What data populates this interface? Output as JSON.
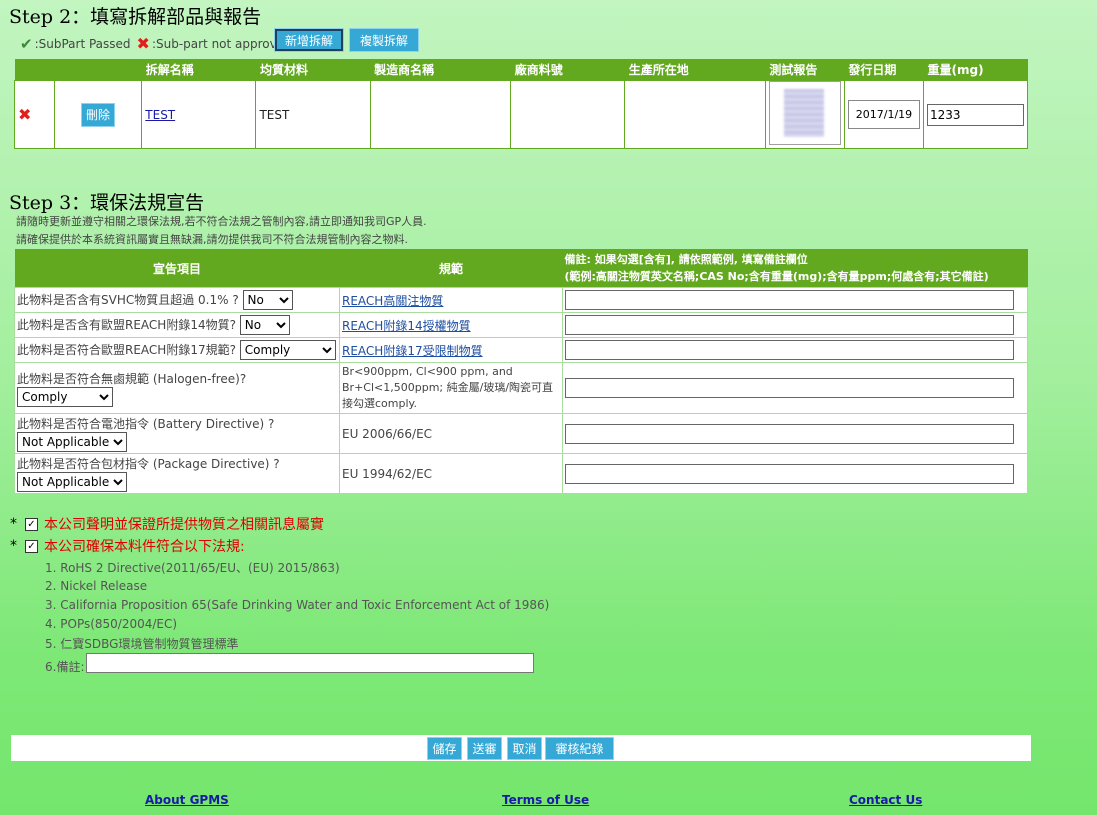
{
  "step2": {
    "title": "Step 2：填寫拆解部品與報告",
    "legend_passed": ":SubPart Passed",
    "legend_not_approved": ":Sub-part not approved",
    "add_button": "新增拆解",
    "copy_button": "複製拆解",
    "columns": [
      "",
      "",
      "拆解名稱",
      "均質材料",
      "製造商名稱",
      "廠商料號",
      "生產所在地",
      "測試報告",
      "發行日期",
      "重量(mg)"
    ],
    "row": {
      "delete_button": "刪除",
      "name": "TEST",
      "material": "TEST",
      "manufacturer": "",
      "part_no": "",
      "location": "",
      "date": "2017/1/19",
      "weight": "1233"
    }
  },
  "step3": {
    "title": "Step 3：環保法規宣告",
    "notice1": "請隨時更新並遵守相關之環保法規,若不符合法規之管制內容,請立即通知我司GP人員.",
    "notice2": "請確保提供於本系統資訊屬實且無缺漏,請勿提供我司不符合法規管制內容之物料.",
    "col_item": "宣告項目",
    "col_spec": "規範",
    "col_note_line1": "備註: 如果勾選[含有], 請依照範例, 填寫備註欄位",
    "col_note_line2": "(範例:高關注物質英文名稱;CAS No;含有重量(mg);含有量ppm;何處含有;其它備註)",
    "rows": [
      {
        "question": "此物料是否含有SVHC物質且超過 0.1% ?",
        "value": "No",
        "spec": "REACH高關注物質"
      },
      {
        "question": "此物料是否含有歐盟REACH附錄14物質?",
        "value": "No",
        "spec": "REACH附錄14授權物質"
      },
      {
        "question": "此物料是否符合歐盟REACH附錄17規範?",
        "value": "Comply",
        "spec": "REACH附錄17受限制物質"
      },
      {
        "question": "此物料是否符合無鹵規範 (Halogen-free)?",
        "value": "Comply",
        "spec": "Br<900ppm, Cl<900 ppm, and Br+Cl<1,500ppm; 純金屬/玻璃/陶瓷可直接勾選comply."
      },
      {
        "question": "此物料是否符合電池指令 (Battery Directive) ?",
        "value": "Not Applicable",
        "spec": "EU 2006/66/EC"
      },
      {
        "question": "此物料是否符合包材指令 (Package Directive) ?",
        "value": "Not Applicable",
        "spec": "EU 1994/62/EC"
      }
    ]
  },
  "declarations": {
    "star": "*",
    "check": "✓",
    "decl1": "本公司聲明並保證所提供物質之相關訊息屬實",
    "decl2": "本公司確保本料件符合以下法規:",
    "laws": [
      "1. RoHS 2 Directive(2011/65/EU、(EU) 2015/863)",
      "2. Nickel Release",
      "3. California Proposition 65(Safe Drinking Water and Toxic Enforcement Act of 1986)",
      "4. POPs(850/2004/EC)",
      "5. 仁寶SDBG環境管制物質管理標準"
    ],
    "note_label": "6.備註:",
    "note_value": ""
  },
  "actions": {
    "save": "儲存",
    "submit": "送審",
    "cancel": "取消",
    "audit_log": "審核紀錄"
  },
  "footer": {
    "about": "About GPMS",
    "terms": "Terms of Use",
    "contact": "Contact Us"
  }
}
